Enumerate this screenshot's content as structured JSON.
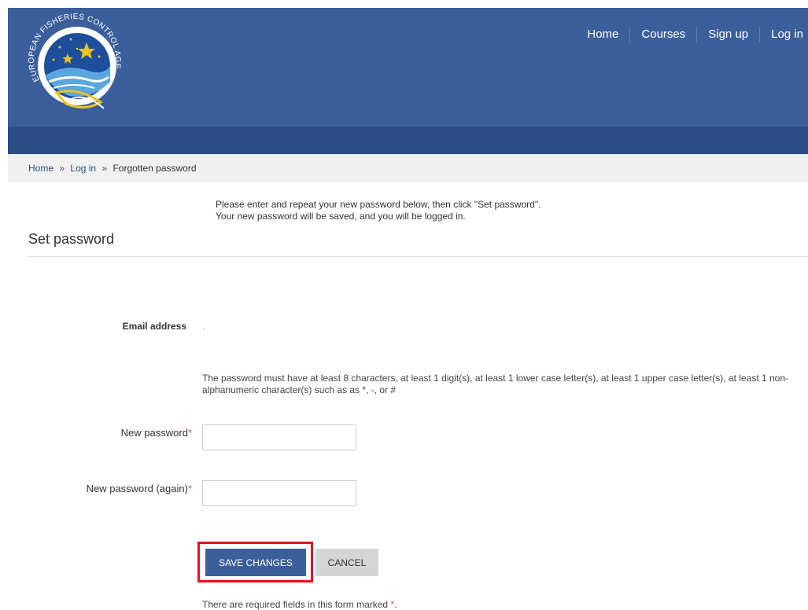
{
  "nav": {
    "home": "Home",
    "courses": "Courses",
    "signup": "Sign up",
    "login": "Log in"
  },
  "logo": {
    "text_top": "EUROPEAN FISHERIES CONTROL AGENCY"
  },
  "breadcrumb": {
    "home": "Home",
    "sep": "»",
    "login": "Log in",
    "current": "Forgotten password"
  },
  "instructions": {
    "line1": "Please enter and repeat your new password below, then click \"Set password\".",
    "line2": "Your new password will be saved, and you will be logged in."
  },
  "page_title": "Set password",
  "form": {
    "email_label": "Email address",
    "email_value": ".",
    "policy": "The password must have at least 8 characters, at least 1 digit(s), at least 1 lower case letter(s), at least 1 upper case letter(s), at least 1 non-alphanumeric character(s) such as as *, -, or #",
    "new_password_label": "New password",
    "new_password_again_label": "New password (again)",
    "required_marker": "*",
    "new_password_value": "",
    "new_password_again_value": "",
    "save_label": "SAVE CHANGES",
    "cancel_label": "CANCEL",
    "footnote": "There are required fields in this form marked",
    "footnote_marker": "*",
    "footnote_end": "."
  },
  "colors": {
    "header": "#3b5f9b",
    "subbar": "#2d4e85",
    "highlight": "#e0141a",
    "required": "#d9534f"
  }
}
